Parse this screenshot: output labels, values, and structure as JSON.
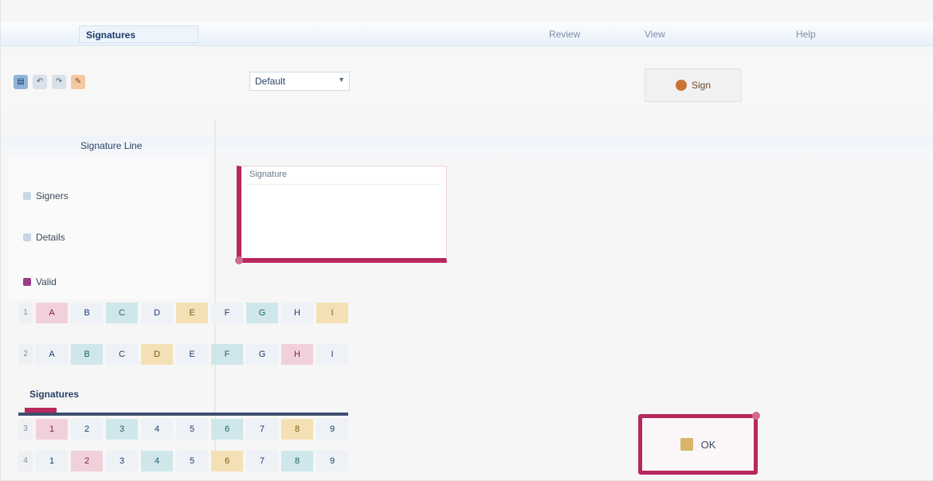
{
  "tabs": {
    "active": "Signatures",
    "right": [
      "Review",
      "View",
      "Help"
    ]
  },
  "toolbar": {
    "qat_icons": [
      "file-icon",
      "undo-icon",
      "redo-icon",
      "format-icon"
    ],
    "combo_value": "Default",
    "sign_button_label": "Sign"
  },
  "rowbar": {
    "namebox": "Signature Line"
  },
  "left_panel": {
    "items": [
      "Signers",
      "Details",
      "Valid"
    ]
  },
  "highlight_box": {
    "label": "Signature"
  },
  "grid": {
    "row_headers": [
      "1",
      "2",
      "3",
      "4"
    ],
    "rows": [
      [
        "A",
        "B",
        "C",
        "D",
        "E",
        "F",
        "G",
        "H",
        "I"
      ],
      [
        "A",
        "B",
        "C",
        "D",
        "E",
        "F",
        "G",
        "H",
        "I"
      ],
      [
        "1",
        "2",
        "3",
        "4",
        "5",
        "6",
        "7",
        "8",
        "9"
      ],
      [
        "1",
        "2",
        "3",
        "4",
        "5",
        "6",
        "7",
        "8",
        "9"
      ]
    ],
    "section_title": "Signatures"
  },
  "ok_button": {
    "label": "OK"
  },
  "colors": {
    "accent": "#b8275d",
    "tab_text": "#1e3c6e"
  }
}
